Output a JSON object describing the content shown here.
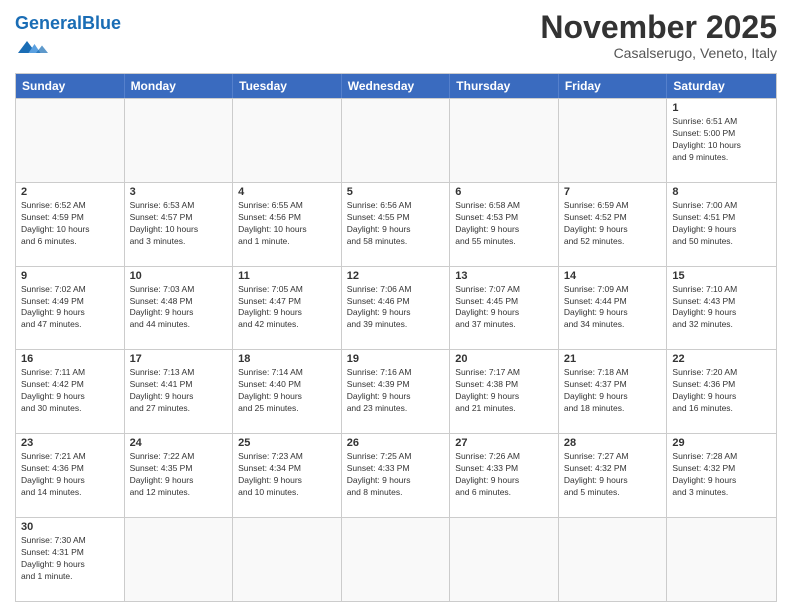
{
  "logo": {
    "text_general": "General",
    "text_blue": "Blue"
  },
  "title": "November 2025",
  "subtitle": "Casalserugo, Veneto, Italy",
  "headers": [
    "Sunday",
    "Monday",
    "Tuesday",
    "Wednesday",
    "Thursday",
    "Friday",
    "Saturday"
  ],
  "rows": [
    [
      {
        "day": "",
        "info": ""
      },
      {
        "day": "",
        "info": ""
      },
      {
        "day": "",
        "info": ""
      },
      {
        "day": "",
        "info": ""
      },
      {
        "day": "",
        "info": ""
      },
      {
        "day": "",
        "info": ""
      },
      {
        "day": "1",
        "info": "Sunrise: 6:51 AM\nSunset: 5:00 PM\nDaylight: 10 hours\nand 9 minutes."
      }
    ],
    [
      {
        "day": "2",
        "info": "Sunrise: 6:52 AM\nSunset: 4:59 PM\nDaylight: 10 hours\nand 6 minutes."
      },
      {
        "day": "3",
        "info": "Sunrise: 6:53 AM\nSunset: 4:57 PM\nDaylight: 10 hours\nand 3 minutes."
      },
      {
        "day": "4",
        "info": "Sunrise: 6:55 AM\nSunset: 4:56 PM\nDaylight: 10 hours\nand 1 minute."
      },
      {
        "day": "5",
        "info": "Sunrise: 6:56 AM\nSunset: 4:55 PM\nDaylight: 9 hours\nand 58 minutes."
      },
      {
        "day": "6",
        "info": "Sunrise: 6:58 AM\nSunset: 4:53 PM\nDaylight: 9 hours\nand 55 minutes."
      },
      {
        "day": "7",
        "info": "Sunrise: 6:59 AM\nSunset: 4:52 PM\nDaylight: 9 hours\nand 52 minutes."
      },
      {
        "day": "8",
        "info": "Sunrise: 7:00 AM\nSunset: 4:51 PM\nDaylight: 9 hours\nand 50 minutes."
      }
    ],
    [
      {
        "day": "9",
        "info": "Sunrise: 7:02 AM\nSunset: 4:49 PM\nDaylight: 9 hours\nand 47 minutes."
      },
      {
        "day": "10",
        "info": "Sunrise: 7:03 AM\nSunset: 4:48 PM\nDaylight: 9 hours\nand 44 minutes."
      },
      {
        "day": "11",
        "info": "Sunrise: 7:05 AM\nSunset: 4:47 PM\nDaylight: 9 hours\nand 42 minutes."
      },
      {
        "day": "12",
        "info": "Sunrise: 7:06 AM\nSunset: 4:46 PM\nDaylight: 9 hours\nand 39 minutes."
      },
      {
        "day": "13",
        "info": "Sunrise: 7:07 AM\nSunset: 4:45 PM\nDaylight: 9 hours\nand 37 minutes."
      },
      {
        "day": "14",
        "info": "Sunrise: 7:09 AM\nSunset: 4:44 PM\nDaylight: 9 hours\nand 34 minutes."
      },
      {
        "day": "15",
        "info": "Sunrise: 7:10 AM\nSunset: 4:43 PM\nDaylight: 9 hours\nand 32 minutes."
      }
    ],
    [
      {
        "day": "16",
        "info": "Sunrise: 7:11 AM\nSunset: 4:42 PM\nDaylight: 9 hours\nand 30 minutes."
      },
      {
        "day": "17",
        "info": "Sunrise: 7:13 AM\nSunset: 4:41 PM\nDaylight: 9 hours\nand 27 minutes."
      },
      {
        "day": "18",
        "info": "Sunrise: 7:14 AM\nSunset: 4:40 PM\nDaylight: 9 hours\nand 25 minutes."
      },
      {
        "day": "19",
        "info": "Sunrise: 7:16 AM\nSunset: 4:39 PM\nDaylight: 9 hours\nand 23 minutes."
      },
      {
        "day": "20",
        "info": "Sunrise: 7:17 AM\nSunset: 4:38 PM\nDaylight: 9 hours\nand 21 minutes."
      },
      {
        "day": "21",
        "info": "Sunrise: 7:18 AM\nSunset: 4:37 PM\nDaylight: 9 hours\nand 18 minutes."
      },
      {
        "day": "22",
        "info": "Sunrise: 7:20 AM\nSunset: 4:36 PM\nDaylight: 9 hours\nand 16 minutes."
      }
    ],
    [
      {
        "day": "23",
        "info": "Sunrise: 7:21 AM\nSunset: 4:36 PM\nDaylight: 9 hours\nand 14 minutes."
      },
      {
        "day": "24",
        "info": "Sunrise: 7:22 AM\nSunset: 4:35 PM\nDaylight: 9 hours\nand 12 minutes."
      },
      {
        "day": "25",
        "info": "Sunrise: 7:23 AM\nSunset: 4:34 PM\nDaylight: 9 hours\nand 10 minutes."
      },
      {
        "day": "26",
        "info": "Sunrise: 7:25 AM\nSunset: 4:33 PM\nDaylight: 9 hours\nand 8 minutes."
      },
      {
        "day": "27",
        "info": "Sunrise: 7:26 AM\nSunset: 4:33 PM\nDaylight: 9 hours\nand 6 minutes."
      },
      {
        "day": "28",
        "info": "Sunrise: 7:27 AM\nSunset: 4:32 PM\nDaylight: 9 hours\nand 5 minutes."
      },
      {
        "day": "29",
        "info": "Sunrise: 7:28 AM\nSunset: 4:32 PM\nDaylight: 9 hours\nand 3 minutes."
      }
    ],
    [
      {
        "day": "30",
        "info": "Sunrise: 7:30 AM\nSunset: 4:31 PM\nDaylight: 9 hours\nand 1 minute."
      },
      {
        "day": "",
        "info": ""
      },
      {
        "day": "",
        "info": ""
      },
      {
        "day": "",
        "info": ""
      },
      {
        "day": "",
        "info": ""
      },
      {
        "day": "",
        "info": ""
      },
      {
        "day": "",
        "info": ""
      }
    ]
  ]
}
